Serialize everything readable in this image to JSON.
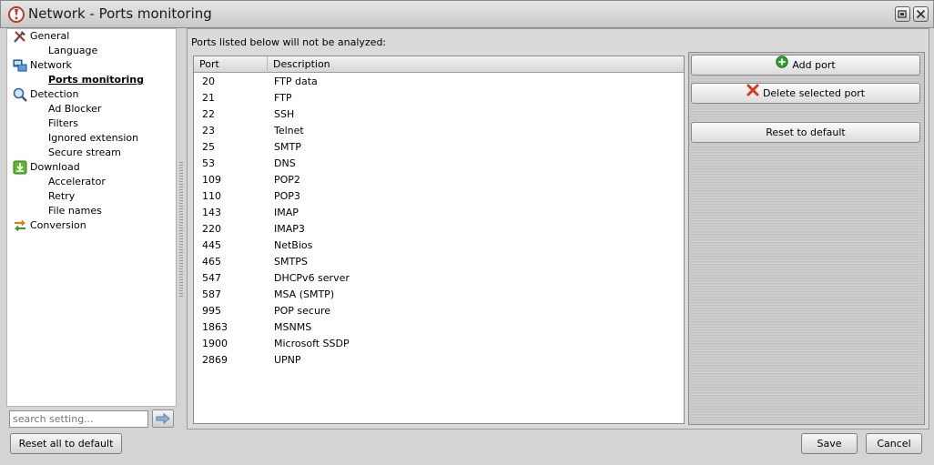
{
  "window": {
    "title": "Network - Ports monitoring"
  },
  "nav": {
    "items": [
      {
        "label": "General",
        "icon": "tools-icon",
        "children": [
          "Language"
        ]
      },
      {
        "label": "Network",
        "icon": "network-icon",
        "children": [
          "Ports monitoring"
        ]
      },
      {
        "label": "Detection",
        "icon": "magnifier-icon",
        "children": [
          "Ad Blocker",
          "Filters",
          "Ignored extension",
          "Secure stream"
        ]
      },
      {
        "label": "Download",
        "icon": "download-icon",
        "children": [
          "Accelerator",
          "Retry",
          "File names"
        ]
      },
      {
        "label": "Conversion",
        "icon": "convert-icon",
        "children": []
      }
    ],
    "active": "Ports monitoring"
  },
  "search": {
    "placeholder": "search setting...",
    "value": ""
  },
  "main": {
    "caption": "Ports listed below will not be analyzed:",
    "columns": [
      "Port",
      "Description"
    ],
    "rows": [
      [
        "20",
        "FTP data"
      ],
      [
        "21",
        "FTP"
      ],
      [
        "22",
        "SSH"
      ],
      [
        "23",
        "Telnet"
      ],
      [
        "25",
        "SMTP"
      ],
      [
        "53",
        "DNS"
      ],
      [
        "109",
        "POP2"
      ],
      [
        "110",
        "POP3"
      ],
      [
        "143",
        "IMAP"
      ],
      [
        "220",
        "IMAP3"
      ],
      [
        "445",
        "NetBios"
      ],
      [
        "465",
        "SMTPS"
      ],
      [
        "547",
        "DHCPv6 server"
      ],
      [
        "587",
        "MSA (SMTP)"
      ],
      [
        "995",
        "POP secure"
      ],
      [
        "1863",
        "MSNMS"
      ],
      [
        "1900",
        "Microsoft SSDP"
      ],
      [
        "2869",
        "UPNP"
      ]
    ]
  },
  "actions": {
    "add_port": "Add port",
    "delete_port": "Delete selected port",
    "reset_default": "Reset to default"
  },
  "footer": {
    "reset_all": "Reset all to default",
    "save": "Save",
    "cancel": "Cancel"
  },
  "colors": {
    "add_icon": "#2fa32f",
    "delete_icon": "#d93a1e",
    "accent_icon": "#c0392b"
  }
}
